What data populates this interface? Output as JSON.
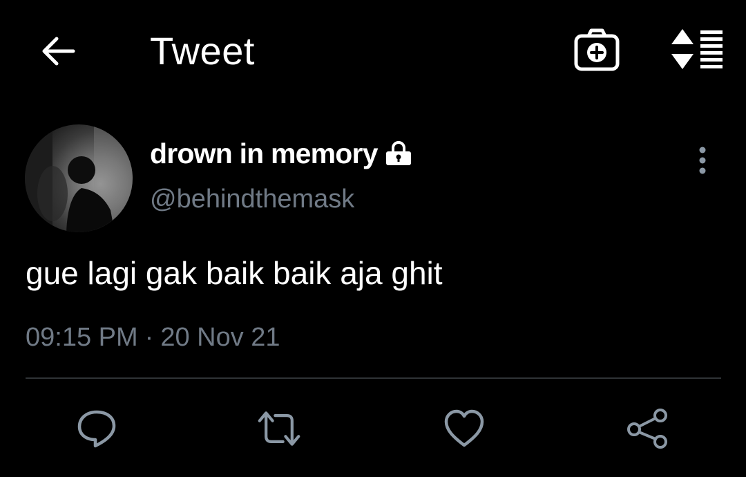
{
  "header": {
    "title": "Tweet",
    "back_icon": "arrow-left-icon",
    "camera_icon": "camera-plus-icon",
    "sort_icon": "sort-list-icon"
  },
  "author": {
    "display_name": "drown in memory",
    "handle": "@behindthemask",
    "protected_icon": "lock-icon",
    "more_icon": "vertical-ellipsis-icon"
  },
  "tweet": {
    "text": "gue lagi gak baik baik aja ghit",
    "time": "09:15 PM",
    "separator": "·",
    "date": "20 Nov 21"
  },
  "actions": [
    {
      "name": "reply",
      "icon": "reply-bubble-icon"
    },
    {
      "name": "retweet",
      "icon": "retweet-icon"
    },
    {
      "name": "like",
      "icon": "heart-icon"
    },
    {
      "name": "share",
      "icon": "share-icon"
    }
  ],
  "colors": {
    "background": "#000000",
    "text_primary": "#ffffff",
    "text_secondary": "#707a86",
    "icon_secondary": "#8b98a5",
    "divider": "#2f3336"
  }
}
